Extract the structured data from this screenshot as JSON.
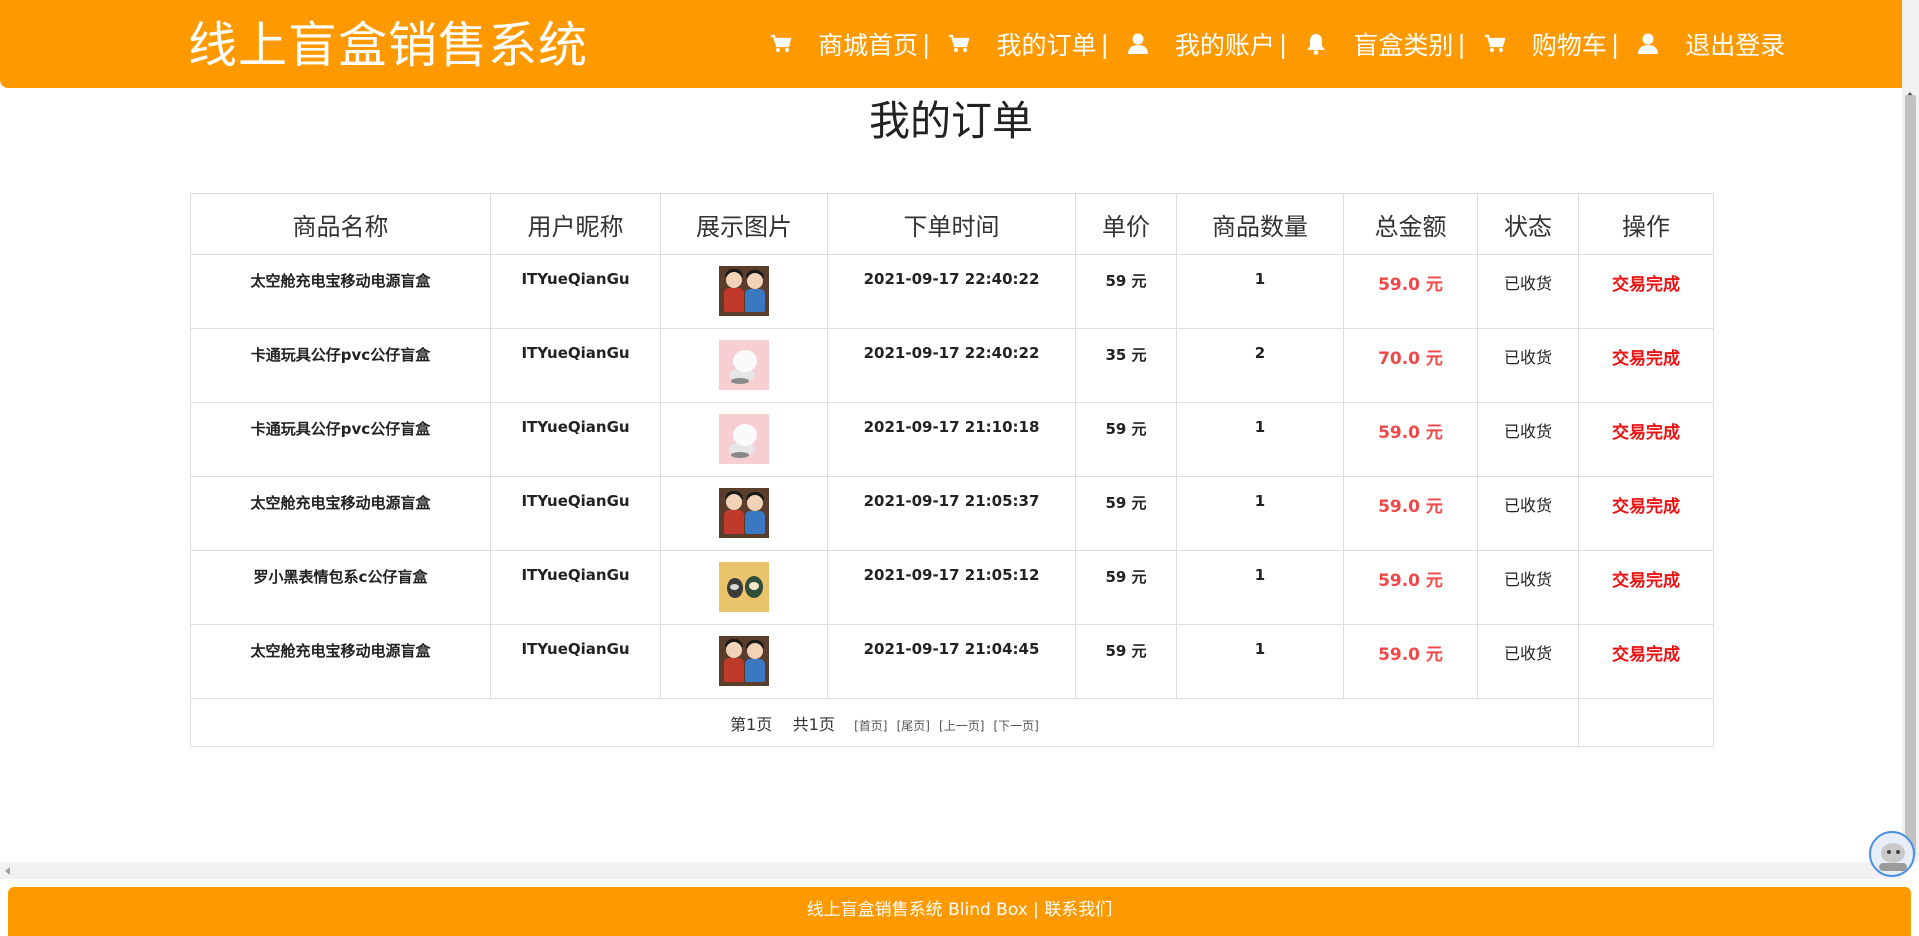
{
  "header": {
    "brand": "线上盲盒销售系统",
    "nav": [
      {
        "icon": "cart-icon",
        "label": "商城首页",
        "sep": "|"
      },
      {
        "icon": "cart-icon",
        "label": "我的订单",
        "sep": "|"
      },
      {
        "icon": "user-icon",
        "label": "我的账户",
        "sep": " |"
      },
      {
        "icon": "bell-icon",
        "label": "盲盒类别",
        "sep": " |"
      },
      {
        "icon": "cart-icon",
        "label": "购物车",
        "sep": "|"
      },
      {
        "icon": "user-icon",
        "label": "退出登录",
        "sep": ""
      }
    ],
    "accent_color": "#ff9900"
  },
  "page": {
    "title": "我的订单"
  },
  "table": {
    "columns": [
      "商品名称",
      "用户昵称",
      "展示图片",
      "下单时间",
      "单价",
      "商品数量",
      "总金额",
      "状态",
      "操作"
    ],
    "rows": [
      {
        "name": "太空舱充电宝移动电源盲盒",
        "user": "ITYueQianGu",
        "image": "space-capsule-toy-image",
        "time": "2021-09-17 22:40:22",
        "price": "59 元",
        "qty": "1",
        "total": "59.0 元",
        "status": "已收货",
        "action": "交易完成"
      },
      {
        "name": "卡通玩具公仔pvc公仔盲盒",
        "user": "ITYueQianGu",
        "image": "cartoon-doll-image",
        "time": "2021-09-17 22:40:22",
        "price": "35 元",
        "qty": "2",
        "total": "70.0 元",
        "status": "已收货",
        "action": "交易完成"
      },
      {
        "name": "卡通玩具公仔pvc公仔盲盒",
        "user": "ITYueQianGu",
        "image": "cartoon-doll-image",
        "time": "2021-09-17 21:10:18",
        "price": "59 元",
        "qty": "1",
        "total": "59.0 元",
        "status": "已收货",
        "action": "交易完成"
      },
      {
        "name": "太空舱充电宝移动电源盲盒",
        "user": "ITYueQianGu",
        "image": "space-capsule-toy-image",
        "time": "2021-09-17 21:05:37",
        "price": "59 元",
        "qty": "1",
        "total": "59.0 元",
        "status": "已收货",
        "action": "交易完成"
      },
      {
        "name": "罗小黑表情包系c公仔盲盒",
        "user": "ITYueQianGu",
        "image": "emoji-figure-image",
        "time": "2021-09-17 21:05:12",
        "price": "59 元",
        "qty": "1",
        "total": "59.0 元",
        "status": "已收货",
        "action": "交易完成"
      },
      {
        "name": "太空舱充电宝移动电源盲盒",
        "user": "ITYueQianGu",
        "image": "space-capsule-toy-image",
        "time": "2021-09-17 21:04:45",
        "price": "59 元",
        "qty": "1",
        "total": "59.0 元",
        "status": "已收货",
        "action": "交易完成"
      }
    ],
    "amount_color": "#f04848",
    "action_color": "#ee1111"
  },
  "pager": {
    "current": "第1页",
    "total": "共1页",
    "first": "[首页]",
    "last": "[尾页]",
    "prev": "[上一页]",
    "next": "[下一页]"
  },
  "footer": {
    "text": "线上盲盒销售系统 Blind Box | ",
    "contact": "联系我们"
  }
}
